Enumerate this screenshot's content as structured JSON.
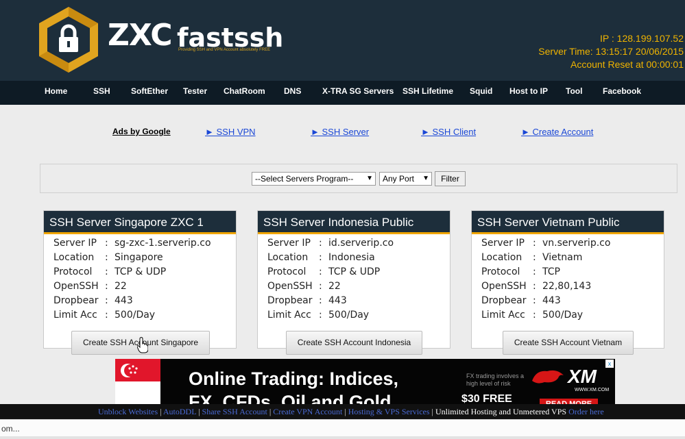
{
  "logo": {
    "brand": "ZXC",
    "name": "fastssh",
    "tagline": "Providing SSH and VPN Account absolutely FREE"
  },
  "server_info": {
    "ip": "IP : 128.199.107.52",
    "time": "Server Time: 13:15:17 20/06/2015",
    "reset": "Account Reset at 00:00:01"
  },
  "nav": [
    "Home",
    "SSH",
    "SoftEther",
    "Tester",
    "ChatRoom",
    "DNS",
    "X-TRA SG Servers",
    "SSH Lifetime",
    "Squid",
    "Host to IP",
    "Tool",
    "Facebook"
  ],
  "ads": {
    "label": "Ads by Google",
    "links": [
      "► SSH VPN",
      "► SSH Server",
      "► SSH Client",
      "► Create Account"
    ]
  },
  "filter": {
    "program_select": "--Select Servers Program--",
    "port_select": "Any Port",
    "button": "Filter"
  },
  "servers": [
    {
      "title": "SSH Server Singapore ZXC 1",
      "rows": [
        [
          "Server IP",
          ":",
          "sg-zxc-1.serverip.co"
        ],
        [
          "Location",
          ":",
          "Singapore"
        ],
        [
          "Protocol",
          ":",
          "TCP & UDP"
        ],
        [
          "OpenSSH",
          ":",
          "22"
        ],
        [
          "Dropbear",
          ":",
          "443"
        ],
        [
          "Limit Acc",
          ":",
          "500/Day"
        ]
      ],
      "button": "Create SSH Account Singapore"
    },
    {
      "title": "SSH Server Indonesia Public",
      "rows": [
        [
          "Server IP",
          ":",
          "id.serverip.co"
        ],
        [
          "Location",
          ":",
          "Indonesia"
        ],
        [
          "Protocol",
          ":",
          "TCP & UDP"
        ],
        [
          "OpenSSH",
          ":",
          "22"
        ],
        [
          "Dropbear",
          ":",
          "443"
        ],
        [
          "Limit Acc",
          ":",
          "500/Day"
        ]
      ],
      "button": "Create SSH Account Indonesia"
    },
    {
      "title": "SSH Server Vietnam Public",
      "rows": [
        [
          "Server IP",
          ":",
          "vn.serverip.co"
        ],
        [
          "Location",
          ":",
          "Vietnam"
        ],
        [
          "Protocol",
          ":",
          "TCP"
        ],
        [
          "OpenSSH",
          ":",
          "22,80,143"
        ],
        [
          "Dropbear",
          ":",
          "443"
        ],
        [
          "Limit Acc",
          ":",
          "500/Day"
        ]
      ],
      "button": "Create SSH Account Vietnam"
    }
  ],
  "ad_banner": {
    "headline1": "Online Trading: Indices,",
    "headline2": "FX, CFDs, Oil and Gold",
    "small": "FX trading involves a high level of risk",
    "free": "$30 FREE",
    "brand": "XM",
    "url": "WWW.XM.COM",
    "cta": "READ MORE",
    "close": "x"
  },
  "footer": [
    {
      "text": "Unblock Websites",
      "link": true
    },
    {
      "text": "AutoDDL",
      "link": true
    },
    {
      "text": "Share SSH Account",
      "link": true
    },
    {
      "text": "Create VPN Account",
      "link": true
    },
    {
      "text": "Hosting & VPS Services",
      "link": true
    },
    {
      "text": "Unlimited Hosting and Unmetered VPS",
      "link": false
    },
    {
      "text": "Order here",
      "link": true
    }
  ],
  "status": "om...",
  "colors": {
    "header": "#1d2e3b",
    "nav": "#0e1b25",
    "accent": "#f0a500",
    "link": "#1a47d6"
  }
}
